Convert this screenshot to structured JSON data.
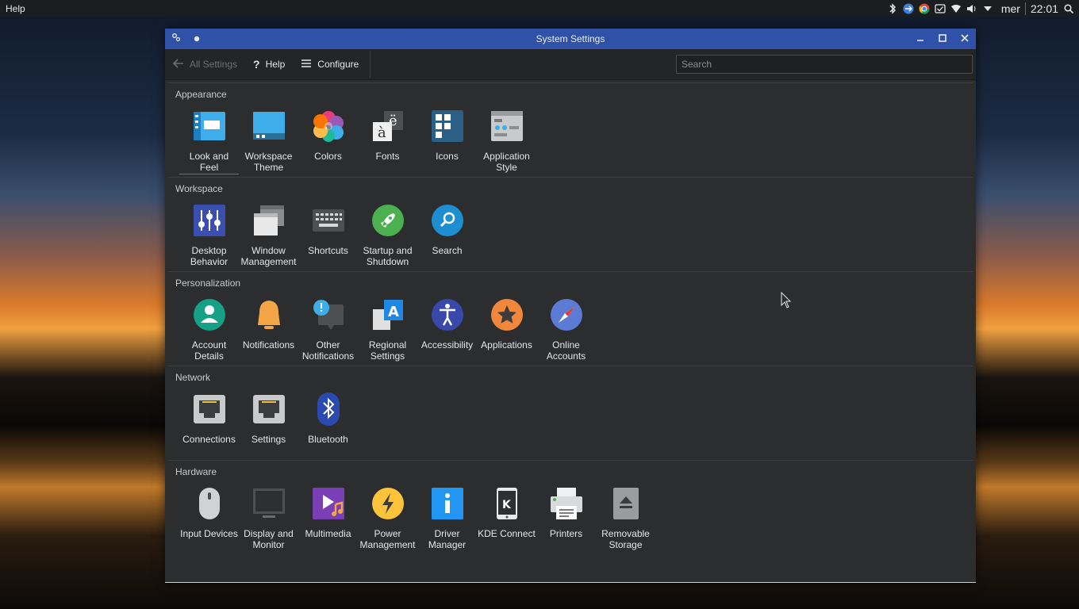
{
  "topbar": {
    "menu_label": "Help",
    "day": "mer",
    "time": "22:01"
  },
  "window": {
    "title": "System Settings"
  },
  "toolbar": {
    "all_settings": "All Settings",
    "help": "Help",
    "configure": "Configure",
    "search_placeholder": "Search"
  },
  "sections": [
    {
      "title": "Appearance",
      "items": [
        {
          "label": "Look and Feel",
          "icon": "look-and-feel-icon"
        },
        {
          "label": "Workspace Theme",
          "icon": "workspace-theme-icon"
        },
        {
          "label": "Colors",
          "icon": "colors-icon"
        },
        {
          "label": "Fonts",
          "icon": "fonts-icon"
        },
        {
          "label": "Icons",
          "icon": "icons-icon"
        },
        {
          "label": "Application Style",
          "icon": "application-style-icon"
        }
      ]
    },
    {
      "title": "Workspace",
      "items": [
        {
          "label": "Desktop Behavior",
          "icon": "desktop-behavior-icon"
        },
        {
          "label": "Window Management",
          "icon": "window-management-icon"
        },
        {
          "label": "Shortcuts",
          "icon": "keyboard-icon"
        },
        {
          "label": "Startup and Shutdown",
          "icon": "rocket-icon"
        },
        {
          "label": "Search",
          "icon": "search-icon"
        }
      ]
    },
    {
      "title": "Personalization",
      "items": [
        {
          "label": "Account Details",
          "icon": "user-icon"
        },
        {
          "label": "Notifications",
          "icon": "bell-icon"
        },
        {
          "label": "Other Notifications",
          "icon": "chat-alert-icon"
        },
        {
          "label": "Regional Settings",
          "icon": "language-icon"
        },
        {
          "label": "Accessibility",
          "icon": "accessibility-icon"
        },
        {
          "label": "Applications",
          "icon": "star-icon"
        },
        {
          "label": "Online Accounts",
          "icon": "compass-icon"
        }
      ]
    },
    {
      "title": "Network",
      "items": [
        {
          "label": "Connections",
          "icon": "ethernet-port-icon"
        },
        {
          "label": "Settings",
          "icon": "ethernet-settings-icon"
        },
        {
          "label": "Bluetooth",
          "icon": "bluetooth-icon"
        }
      ]
    },
    {
      "title": "Hardware",
      "items": [
        {
          "label": "Input Devices",
          "icon": "mouse-icon"
        },
        {
          "label": "Display and Monitor",
          "icon": "monitor-icon"
        },
        {
          "label": "Multimedia",
          "icon": "multimedia-icon"
        },
        {
          "label": "Power Management",
          "icon": "power-icon"
        },
        {
          "label": "Driver Manager",
          "icon": "info-icon"
        },
        {
          "label": "KDE Connect",
          "icon": "kde-connect-icon"
        },
        {
          "label": "Printers",
          "icon": "printer-icon"
        },
        {
          "label": "Removable Storage",
          "icon": "eject-icon"
        }
      ]
    }
  ],
  "colors": {
    "titlebar": "#2f52a8",
    "window_bg": "#2b2d2f",
    "toolbar_bg": "#232527"
  }
}
